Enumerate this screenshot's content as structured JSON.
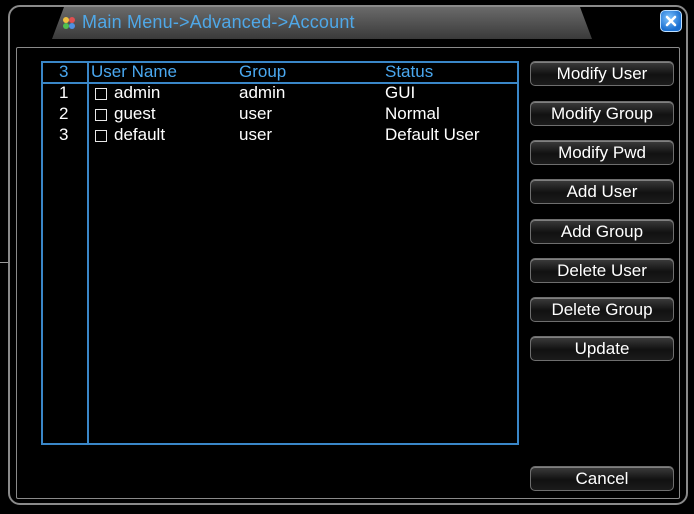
{
  "window": {
    "title": "Main Menu->Advanced->Account",
    "close_icon": "close-icon"
  },
  "table": {
    "count": "3",
    "headers": {
      "user_name": "User Name",
      "group": "Group",
      "status": "Status"
    },
    "rows": [
      {
        "num": "1",
        "user_name": "admin",
        "group": "admin",
        "status": "GUI",
        "checked": false
      },
      {
        "num": "2",
        "user_name": "guest",
        "group": "user",
        "status": "Normal",
        "checked": false
      },
      {
        "num": "3",
        "user_name": "default",
        "group": "user",
        "status": "Default User",
        "checked": false
      }
    ]
  },
  "buttons": {
    "modify_user": "Modify User",
    "modify_group": "Modify Group",
    "modify_pwd": "Modify Pwd",
    "add_user": "Add User",
    "add_group": "Add Group",
    "delete_user": "Delete User",
    "delete_group": "Delete Group",
    "update": "Update",
    "cancel": "Cancel"
  },
  "colors": {
    "title_text": "#4fa8e8",
    "table_border": "#3a87c8",
    "header_text": "#4aa8f0",
    "cell_text": "#ffffff",
    "background": "#000000"
  }
}
